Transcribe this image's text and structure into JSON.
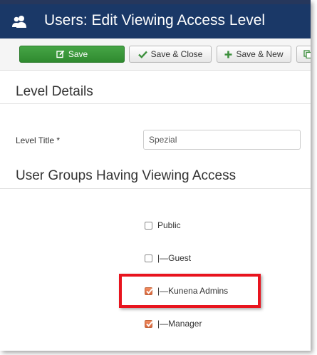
{
  "header": {
    "title": "Users: Edit Viewing Access Level",
    "icon": "users-icon",
    "background_color": "#1a3867"
  },
  "toolbar": {
    "save_label": "Save",
    "save_close_label": "Save & Close",
    "save_new_label": "Save & New",
    "save_color": "#46a546"
  },
  "details": {
    "heading": "Level Details",
    "title_label": "Level Title *",
    "title_value": "Spezial"
  },
  "groups": {
    "heading": "User Groups Having Viewing Access",
    "items": [
      {
        "label": "Public",
        "checked": false
      },
      {
        "label": "|—Guest",
        "checked": false
      },
      {
        "label": "|—Kunena Admins",
        "checked": true
      },
      {
        "label": "|—Manager",
        "checked": true
      }
    ]
  },
  "annotation": {
    "highlight_color": "#e8141e"
  }
}
